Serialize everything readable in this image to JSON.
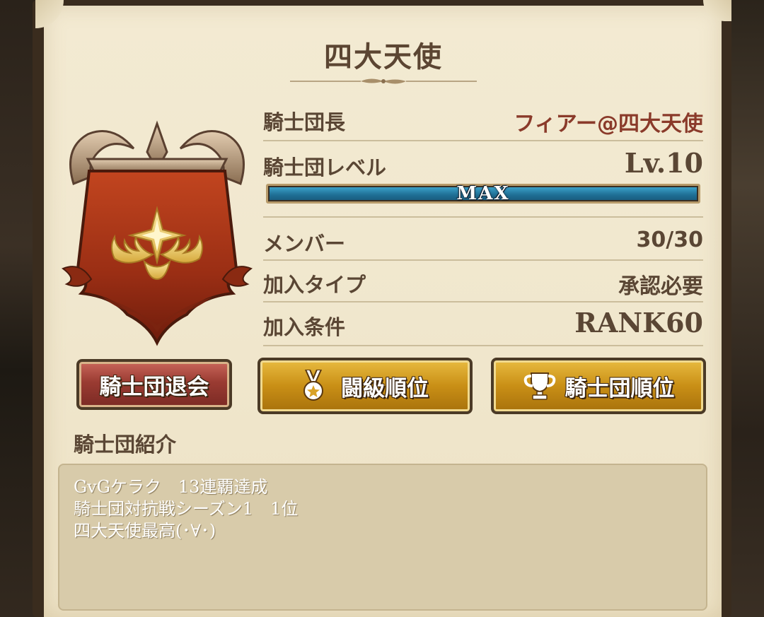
{
  "guild": {
    "name": "四大天使",
    "rows": [
      {
        "label": "騎士団長",
        "value": "フィアー@四大天使"
      },
      {
        "label": "騎士団レベル",
        "value": "Lv.10"
      },
      {
        "label": "メンバー",
        "value": "30/30"
      },
      {
        "label": "加入タイプ",
        "value": "承認必要"
      },
      {
        "label": "加入条件",
        "value": "RANK60"
      }
    ],
    "level_bar": {
      "label": "MAX",
      "progress": 1.0
    }
  },
  "buttons": {
    "leave": "騎士団退会",
    "battle_rank": "闘級順位",
    "knight_rank": "騎士団順位"
  },
  "intro": {
    "heading": "騎士団紹介",
    "lines": [
      "GvGケラク　13連覇達成",
      "騎士団対抗戦シーズン1　1位",
      "四大天使最高(･∀･)"
    ]
  },
  "colors": {
    "leader_name": "#8a3a2a",
    "bar_fill": "#2a87b0",
    "gold_button": "#c98f16",
    "red_button": "#9a3b32"
  },
  "icons": [
    "medal-icon",
    "trophy-icon",
    "crest-emblem"
  ]
}
